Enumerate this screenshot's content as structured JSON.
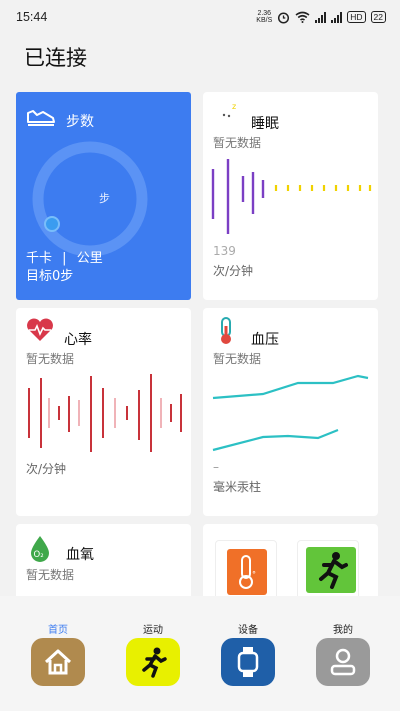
{
  "status_bar": {
    "time": "15:44",
    "net_speed_value": "2.36",
    "net_speed_unit": "KB/S",
    "hd_label": "HD",
    "battery": "22"
  },
  "header": {
    "title": "已连接"
  },
  "cards": {
    "steps": {
      "title": "步数",
      "ring_label": "步",
      "kcal_unit": "千卡",
      "separator": "|",
      "km_unit": "公里",
      "goal": "目标0步"
    },
    "sleep": {
      "title": "睡眠",
      "no_data": "暂无数据",
      "value": "139",
      "unit": "次/分钟"
    },
    "heart": {
      "title": "心率",
      "no_data": "暂无数据",
      "unit": "次/分钟"
    },
    "blood_pressure": {
      "title": "血压",
      "no_data": "暂无数据",
      "dash": "–",
      "unit": "毫米汞柱"
    },
    "oxygen": {
      "title": "血氧",
      "no_data": "暂无数据",
      "icon_text": "O₂"
    }
  },
  "colors": {
    "steps_card": "#3d7cf0",
    "sleep_bars": "#7b3fc4",
    "sleep_dots": "#f0d200",
    "heart_bars": "#c8323a",
    "bp_lines": "#2cc0c4",
    "active_tab": "#3d7cf0",
    "temp_tool": "#f07028",
    "run_tool": "#62c53a"
  },
  "tabs": [
    {
      "label": "首页",
      "icon": "home-icon",
      "active": true
    },
    {
      "label": "运动",
      "icon": "running-icon",
      "active": false
    },
    {
      "label": "设备",
      "icon": "watch-icon",
      "active": false
    },
    {
      "label": "我的",
      "icon": "profile-icon",
      "active": false
    }
  ]
}
